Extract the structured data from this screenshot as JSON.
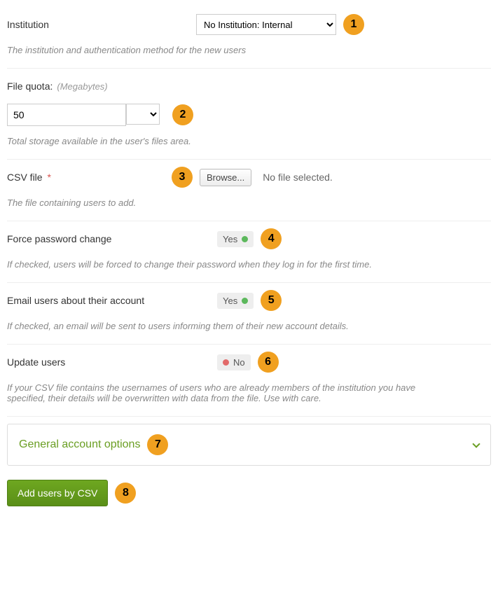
{
  "institution": {
    "label": "Institution",
    "selected": "No Institution: Internal",
    "help": "The institution and authentication method for the new users",
    "callout": "1"
  },
  "quota": {
    "label": "File quota:",
    "unit_label": "(Megabytes)",
    "value": "50",
    "help": "Total storage available in the user's files area.",
    "callout": "2"
  },
  "csv": {
    "label": "CSV file",
    "required_mark": "*",
    "browse_label": "Browse...",
    "file_status": "No file selected.",
    "help": "The file containing users to add.",
    "callout": "3"
  },
  "force_pw": {
    "label": "Force password change",
    "value": "Yes",
    "on": true,
    "help": "If checked, users will be forced to change their password when they log in for the first time.",
    "callout": "4"
  },
  "email_users": {
    "label": "Email users about their account",
    "value": "Yes",
    "on": true,
    "help": "If checked, an email will be sent to users informing them of their new account details.",
    "callout": "5"
  },
  "update_users": {
    "label": "Update users",
    "value": "No",
    "on": false,
    "help": "If your CSV file contains the usernames of users who are already members of the institution you have specified, their details will be overwritten with data from the file. Use with care.",
    "callout": "6"
  },
  "accordion": {
    "label": "General account options",
    "callout": "7"
  },
  "submit": {
    "label": "Add users by CSV",
    "callout": "8"
  }
}
